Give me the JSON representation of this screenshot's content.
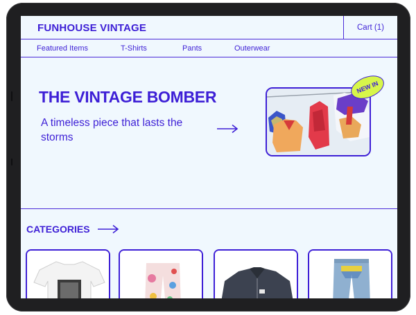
{
  "header": {
    "brand": "FUNHOUSE VINTAGE",
    "cart_label": "Cart (1)"
  },
  "nav": {
    "items": [
      "Featured Items",
      "T-Shirts",
      "Pants",
      "Outerwear"
    ]
  },
  "hero": {
    "title": "THE VINTAGE BOMBER",
    "subtitle": "A timeless piece that lasts the storms",
    "badge": "NEW IN"
  },
  "categories": {
    "title": "CATEGORIES"
  },
  "colors": {
    "accent": "#3d1fd6",
    "background": "#f0f8fe",
    "badge": "#d7f64a"
  },
  "icons": {
    "hero_arrow": "arrow-right-icon",
    "categories_arrow": "arrow-right-icon"
  }
}
